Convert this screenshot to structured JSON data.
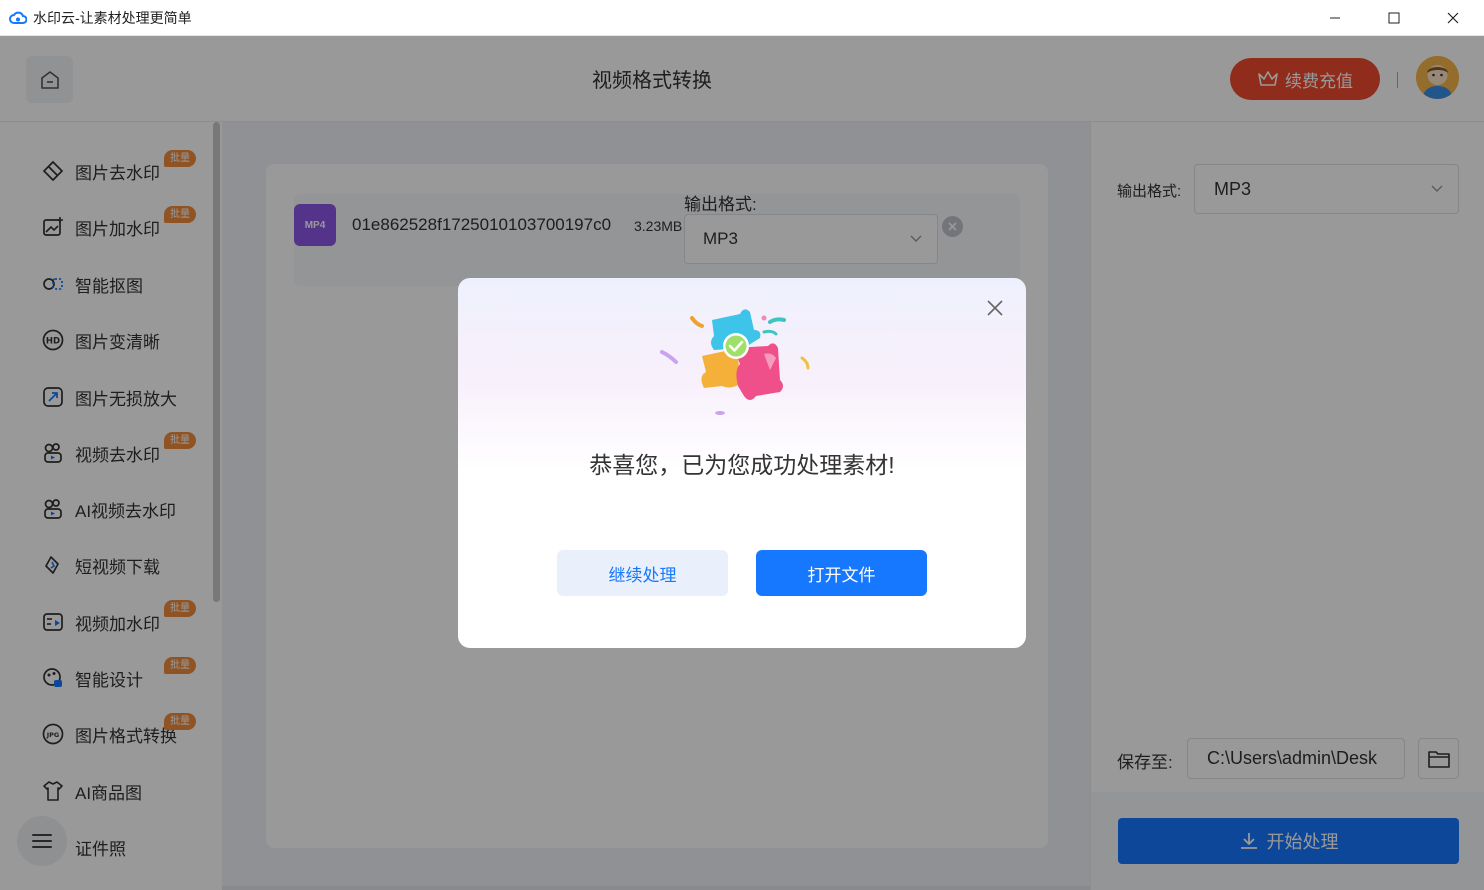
{
  "window": {
    "title": "水印云-让素材处理更简单"
  },
  "header": {
    "title": "视频格式转换",
    "recharge_label": "续费充值"
  },
  "sidebar": {
    "items": [
      {
        "label": "图片去水印",
        "icon": "diamond-eraser-icon",
        "badge": "批量"
      },
      {
        "label": "图片加水印",
        "icon": "image-add-icon",
        "badge": "批量"
      },
      {
        "label": "智能抠图",
        "icon": "cutout-icon",
        "badge": ""
      },
      {
        "label": "图片变清晰",
        "icon": "hd-icon",
        "badge": ""
      },
      {
        "label": "图片无损放大",
        "icon": "enlarge-icon",
        "badge": ""
      },
      {
        "label": "视频去水印",
        "icon": "video-clean-icon",
        "badge": "批量"
      },
      {
        "label": "AI视频去水印",
        "icon": "ai-video-clean-icon",
        "badge": ""
      },
      {
        "label": "短视频下载",
        "icon": "link-download-icon",
        "badge": ""
      },
      {
        "label": "视频加水印",
        "icon": "video-watermark-icon",
        "badge": "批量"
      },
      {
        "label": "智能设计",
        "icon": "design-icon",
        "badge": "批量"
      },
      {
        "label": "图片格式转换",
        "icon": "jpg-convert-icon",
        "badge": "批量"
      },
      {
        "label": "AI商品图",
        "icon": "shirt-icon",
        "badge": ""
      },
      {
        "label": "证件照",
        "icon": "id-photo-icon",
        "badge": ""
      }
    ]
  },
  "main": {
    "file": {
      "type_label": "MP4",
      "name": "01e862528f1725010103700197c0",
      "size": "3.23MB",
      "format_label": "输出格式:",
      "format_value": "MP3"
    }
  },
  "right_panel": {
    "output_label": "输出格式:",
    "output_value": "MP3",
    "save_label": "保存至:",
    "save_path": "C:\\Users\\admin\\Desk",
    "start_label": "开始处理"
  },
  "modal": {
    "message": "恭喜您，已为您成功处理素材!",
    "continue_label": "继续处理",
    "open_label": "打开文件"
  },
  "colors": {
    "accent": "#1677ff",
    "recharge": "#f04a2f",
    "badge": "#f08a3c",
    "file_icon": "#8d55e6"
  }
}
